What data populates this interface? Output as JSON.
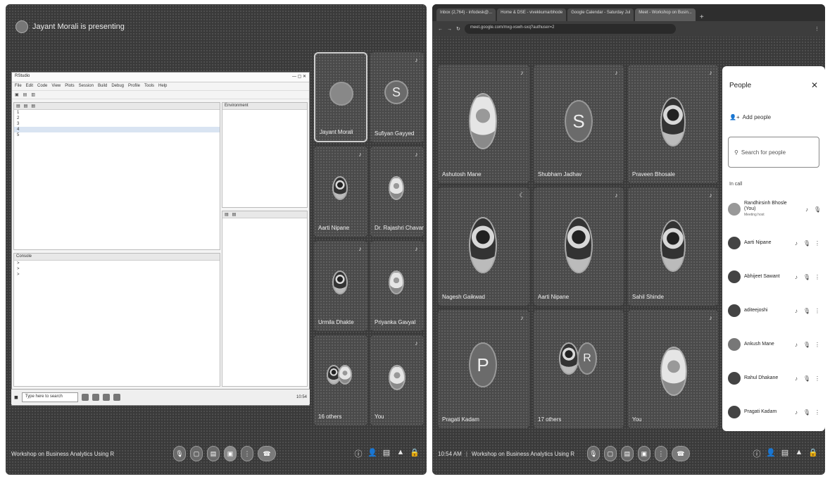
{
  "left": {
    "presenting_banner": "Jayant Morali is presenting",
    "r_window": {
      "title": "RStudio",
      "menu": [
        "File",
        "Edit",
        "Code",
        "View",
        "Plots",
        "Session",
        "Build",
        "Debug",
        "Profile",
        "Tools",
        "Help"
      ],
      "console_label": "Console",
      "environment_label": "Environment",
      "taskbar_search": "Type here to search",
      "clock": "10:54"
    },
    "tiles": [
      {
        "name": "Jayant Morali",
        "kind": "avatar"
      },
      {
        "name": "Sufiyan Gayyed",
        "kind": "letter",
        "letter": "S"
      },
      {
        "name": "Aarti Nipane",
        "kind": "photo"
      },
      {
        "name": "Dr. Rajashri Chavan",
        "kind": "photo"
      },
      {
        "name": "Urmila Dhakte",
        "kind": "photo"
      },
      {
        "name": "Priyanka Gavyal",
        "kind": "photo"
      },
      {
        "name": "16 others",
        "kind": "group"
      },
      {
        "name": "You",
        "kind": "photo"
      }
    ],
    "meeting_name": "Workshop on Business Analytics Using R"
  },
  "right": {
    "browser_tabs": [
      "Inbox (2,764) - infodesk@...",
      "Home & DSE - vivekkumarbhode",
      "Google Calendar - Saturday Jul",
      "Meet - Workshop on Busin..."
    ],
    "url": "meet.google.com/mxg-xswh-sxq?authuser=2",
    "tiles": [
      {
        "name": "Ashutosh Mane",
        "kind": "photo"
      },
      {
        "name": "Shubham Jadhav",
        "kind": "letter",
        "letter": "S"
      },
      {
        "name": "Praveen Bhosale",
        "kind": "photo"
      },
      {
        "name": "Nagesh Gaikwad",
        "kind": "photo"
      },
      {
        "name": "Aarti Nipane",
        "kind": "photo"
      },
      {
        "name": "Sahil Shinde",
        "kind": "photo"
      },
      {
        "name": "Pragati Kadam",
        "kind": "letter",
        "letter": "P"
      },
      {
        "name": "17 others",
        "kind": "group",
        "letter": "R"
      },
      {
        "name": "You",
        "kind": "photo"
      }
    ],
    "time": "10:54 AM",
    "meeting_name": "Workshop on Business Analytics Using R",
    "people_panel": {
      "title": "People",
      "add_people": "Add people",
      "search_placeholder": "Search for people",
      "section": "In call",
      "members": [
        {
          "name": "Randhirsinh Bhosle (You)",
          "sub": "Meeting host"
        },
        {
          "name": "Aarti Nipane",
          "sub": ""
        },
        {
          "name": "Abhijeet Sawant",
          "sub": ""
        },
        {
          "name": "aditeejoshi",
          "sub": ""
        },
        {
          "name": "Ankush Mane",
          "sub": ""
        },
        {
          "name": "Rahul Dhakane",
          "sub": ""
        },
        {
          "name": "Pragati Kadam",
          "sub": ""
        }
      ]
    }
  }
}
